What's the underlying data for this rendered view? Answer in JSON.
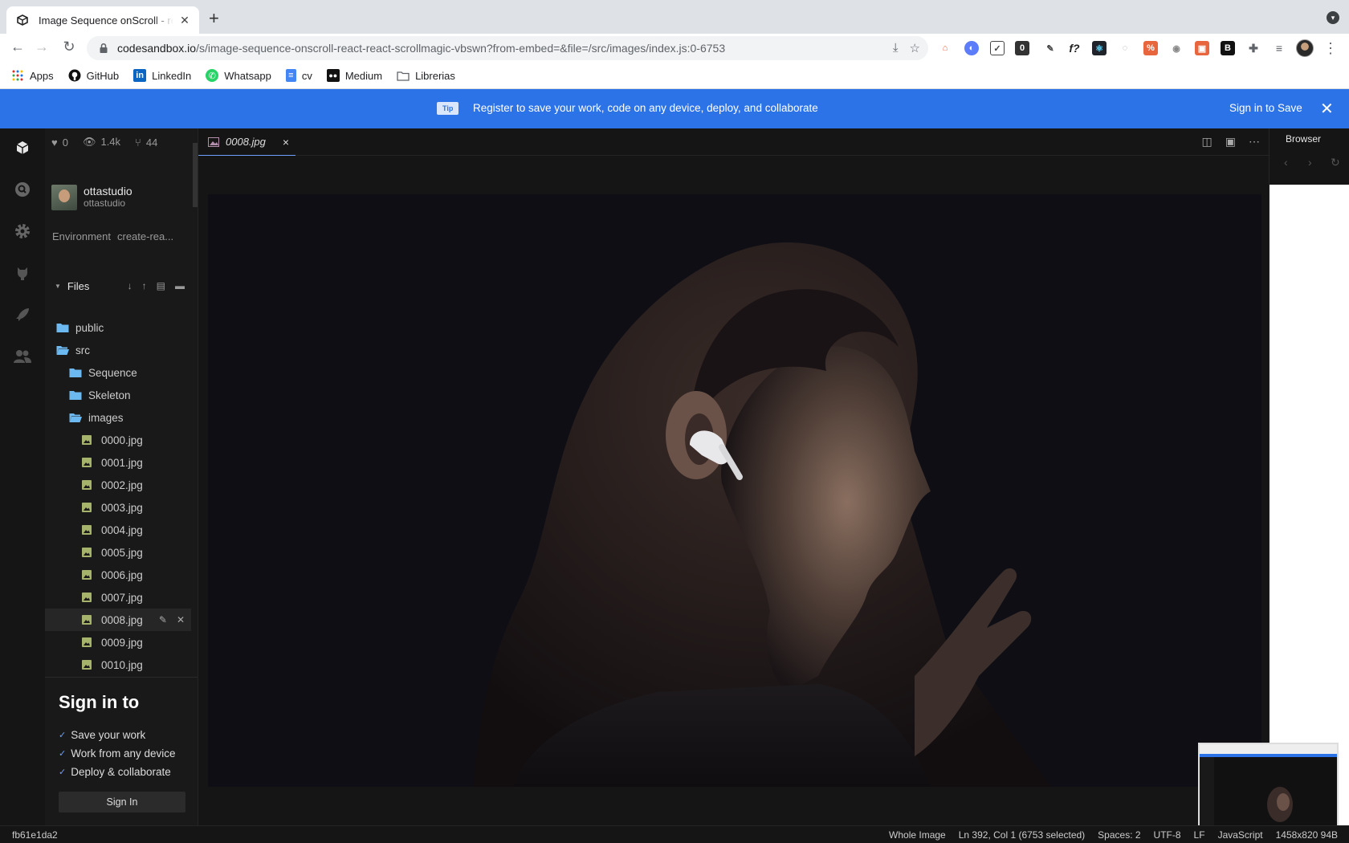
{
  "browser": {
    "tab_title": "Image Sequence onScroll - react-react-scrollmagic",
    "tab_close": "✕",
    "new_tab": "+",
    "url_host": "codesandbox.io",
    "url_path": "/s/image-sequence-onscroll-react-react-scrollmagic-vbswn?from-embed=&file=/src/images/index.js:0-6753",
    "bookmarks": [
      {
        "label": "Apps",
        "icon": "apps-grid-icon"
      },
      {
        "label": "GitHub",
        "icon": "github-icon"
      },
      {
        "label": "LinkedIn",
        "icon": "linkedin-icon"
      },
      {
        "label": "Whatsapp",
        "icon": "whatsapp-icon"
      },
      {
        "label": "cv",
        "icon": "docs-icon"
      },
      {
        "label": "Medium",
        "icon": "medium-icon"
      },
      {
        "label": "Librerias",
        "icon": "folder-icon"
      }
    ]
  },
  "banner": {
    "tip": "Tip",
    "message": "Register to save your work, code on any device, deploy, and collaborate",
    "sign_in": "Sign in to Save"
  },
  "sidebar": {
    "likes": "0",
    "views": "1.4k",
    "forks": "44",
    "user_name": "ottastudio",
    "user_handle": "ottastudio",
    "env_label": "Environment",
    "env_value": "create-rea...",
    "files_title": "Files",
    "tree": [
      {
        "label": "public",
        "type": "folder",
        "depth": 0
      },
      {
        "label": "src",
        "type": "folder-open",
        "depth": 0
      },
      {
        "label": "Sequence",
        "type": "folder",
        "depth": 1
      },
      {
        "label": "Skeleton",
        "type": "folder",
        "depth": 1
      },
      {
        "label": "images",
        "type": "folder-open",
        "depth": 1
      },
      {
        "label": "0000.jpg",
        "type": "image",
        "depth": 2
      },
      {
        "label": "0001.jpg",
        "type": "image",
        "depth": 2
      },
      {
        "label": "0002.jpg",
        "type": "image",
        "depth": 2
      },
      {
        "label": "0003.jpg",
        "type": "image",
        "depth": 2
      },
      {
        "label": "0004.jpg",
        "type": "image",
        "depth": 2
      },
      {
        "label": "0005.jpg",
        "type": "image",
        "depth": 2
      },
      {
        "label": "0006.jpg",
        "type": "image",
        "depth": 2
      },
      {
        "label": "0007.jpg",
        "type": "image",
        "depth": 2
      },
      {
        "label": "0008.jpg",
        "type": "image",
        "depth": 2,
        "selected": true
      },
      {
        "label": "0009.jpg",
        "type": "image",
        "depth": 2
      },
      {
        "label": "0010.jpg",
        "type": "image",
        "depth": 2
      }
    ],
    "signin": {
      "title": "Sign in to",
      "items": [
        "Save your work",
        "Work from any device",
        "Deploy & collaborate"
      ],
      "button": "Sign In"
    }
  },
  "editor": {
    "tab": "0008.jpg",
    "tab_close": "×"
  },
  "preview": {
    "title": "Browser"
  },
  "status": {
    "hash": "fb61e1da2",
    "whole_image": "Whole Image",
    "position": "Ln 392, Col 1 (6753 selected)",
    "spaces": "Spaces: 2",
    "encoding": "UTF-8",
    "eol": "LF",
    "language": "JavaScript",
    "dims": "1458x820 94B"
  },
  "colors": {
    "banner": "#2c73e8",
    "editor_bg": "#151515",
    "accent": "#6ba0ff",
    "folder": "#6cb8f0",
    "image_icon": "#a6b36a"
  }
}
